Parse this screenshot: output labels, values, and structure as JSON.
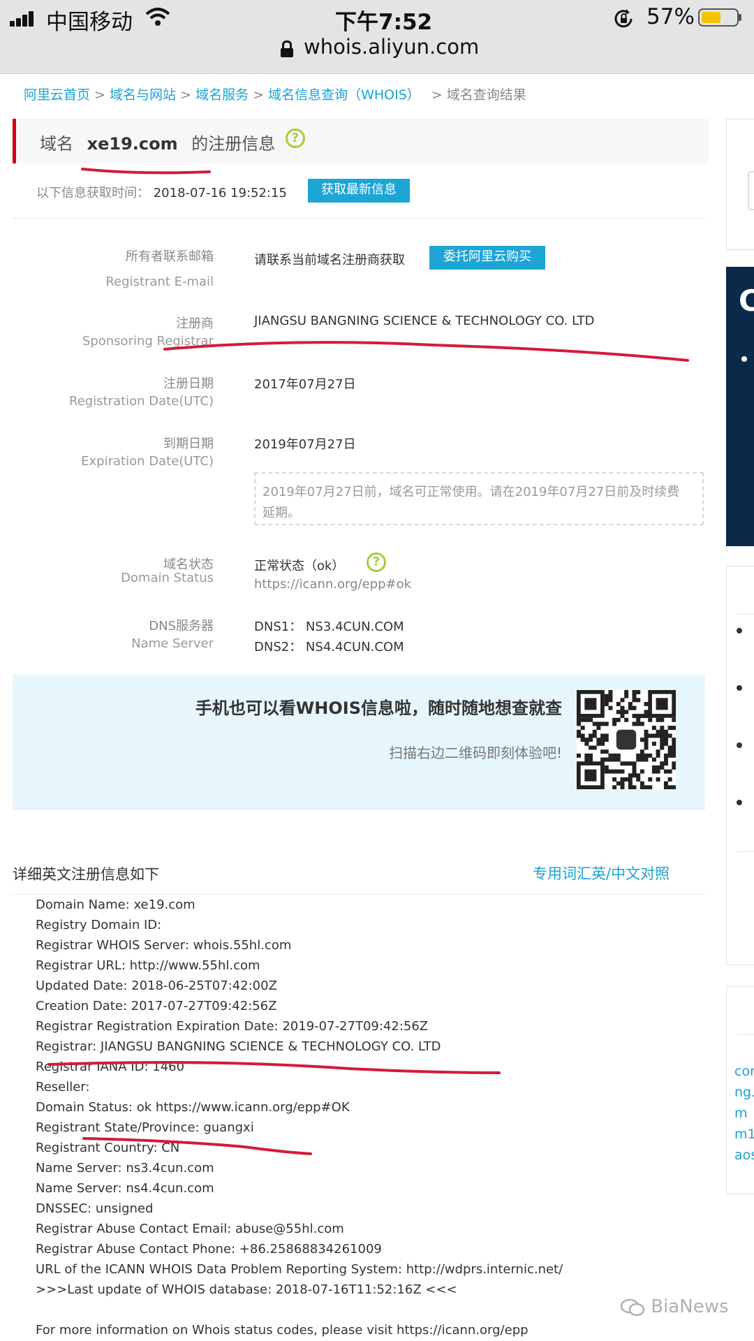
{
  "status_bar": {
    "carrier": "中国移动",
    "time": "下午7:52",
    "battery": "57%",
    "battery_level": 0.57,
    "url": "whois.aliyun.com"
  },
  "breadcrumb": {
    "items": [
      "阿里云首页",
      "域名与网站",
      "域名服务",
      "域名信息查询（WHOIS）"
    ],
    "separator": ">",
    "current": "> 域名查询结果"
  },
  "title": {
    "prefix": "域名",
    "domain": "xe19.com",
    "suffix": "的注册信息",
    "help": "?"
  },
  "fetch": {
    "label": "以下信息获取时间：",
    "time": "2018-07-16 19:52:15",
    "button": "获取最新信息"
  },
  "fields": {
    "email": {
      "cn": "所有者联系邮箱",
      "en": "Registrant E-mail",
      "value": "请联系当前域名注册商获取",
      "button": "委托阿里云购买"
    },
    "registrar": {
      "cn": "注册商",
      "en": "Sponsoring Registrar",
      "value": "JIANGSU BANGNING SCIENCE & TECHNOLOGY CO. LTD"
    },
    "reg_date": {
      "cn": "注册日期",
      "en": "Registration Date(UTC)",
      "value": "2017年07月27日"
    },
    "exp_date": {
      "cn": "到期日期",
      "en": "Expiration Date(UTC)",
      "value": "2019年07月27日",
      "note": [
        "2019年07月27日前，域名可正常使用。请在2019年07月27日前及时续费",
        "延期。"
      ]
    },
    "status": {
      "cn": "域名状态",
      "en": "Domain Status",
      "value": "正常状态（ok）",
      "link": "https://icann.org/epp#ok",
      "help": "?"
    },
    "dns": {
      "cn": "DNS服务器",
      "en": "Name Server",
      "dns1": "DNS1：  NS3.4CUN.COM",
      "dns2": "DNS2：  NS4.4CUN.COM"
    }
  },
  "promo": {
    "headline": "手机也可以看WHOIS信息啦，随时随地想查就查",
    "sub": "扫描右边二维码即刻体验吧!"
  },
  "detail": {
    "heading": "详细英文注册信息如下",
    "glossary": "专用词汇英/中文对照",
    "lines": [
      "Domain Name: xe19.com",
      "Registry Domain ID:",
      "Registrar WHOIS Server: whois.55hl.com",
      "Registrar URL: http://www.55hl.com",
      "Updated Date: 2018-06-25T07:42:00Z",
      "Creation Date: 2017-07-27T09:42:56Z",
      "Registrar Registration Expiration Date: 2019-07-27T09:42:56Z",
      "Registrar: JIANGSU BANGNING SCIENCE & TECHNOLOGY CO. LTD",
      "Registrar IANA ID: 1460",
      "Reseller:",
      "Domain Status: ok https://www.icann.org/epp#OK",
      "Registrant State/Province: guangxi",
      "Registrant Country: CN",
      "Name Server: ns3.4cun.com",
      "Name Server: ns4.4cun.com",
      "DNSSEC: unsigned",
      "Registrar Abuse Contact Email: abuse@55hl.com",
      "Registrar Abuse Contact Phone: +86.25868834261009",
      "URL of the ICANN WHOIS Data Problem Reporting System: http://wdprs.internic.net/",
      ">>>Last update of WHOIS database: 2018-07-16T11:52:16Z <<<",
      "",
      "For more information on Whois status codes, please visit https://icann.org/epp"
    ]
  },
  "sidebar": {
    "partial_links": [
      "cor",
      "ng.",
      "m",
      "m1",
      "aos"
    ],
    "partial_glyph": "C"
  },
  "watermark": "BiaNews",
  "colors": {
    "link": "#1aa3d3",
    "button": "#1da5d6",
    "accent_red": "#d0021b",
    "promo_bg": "#e6f6fc",
    "help_green": "#a6cd3a"
  }
}
